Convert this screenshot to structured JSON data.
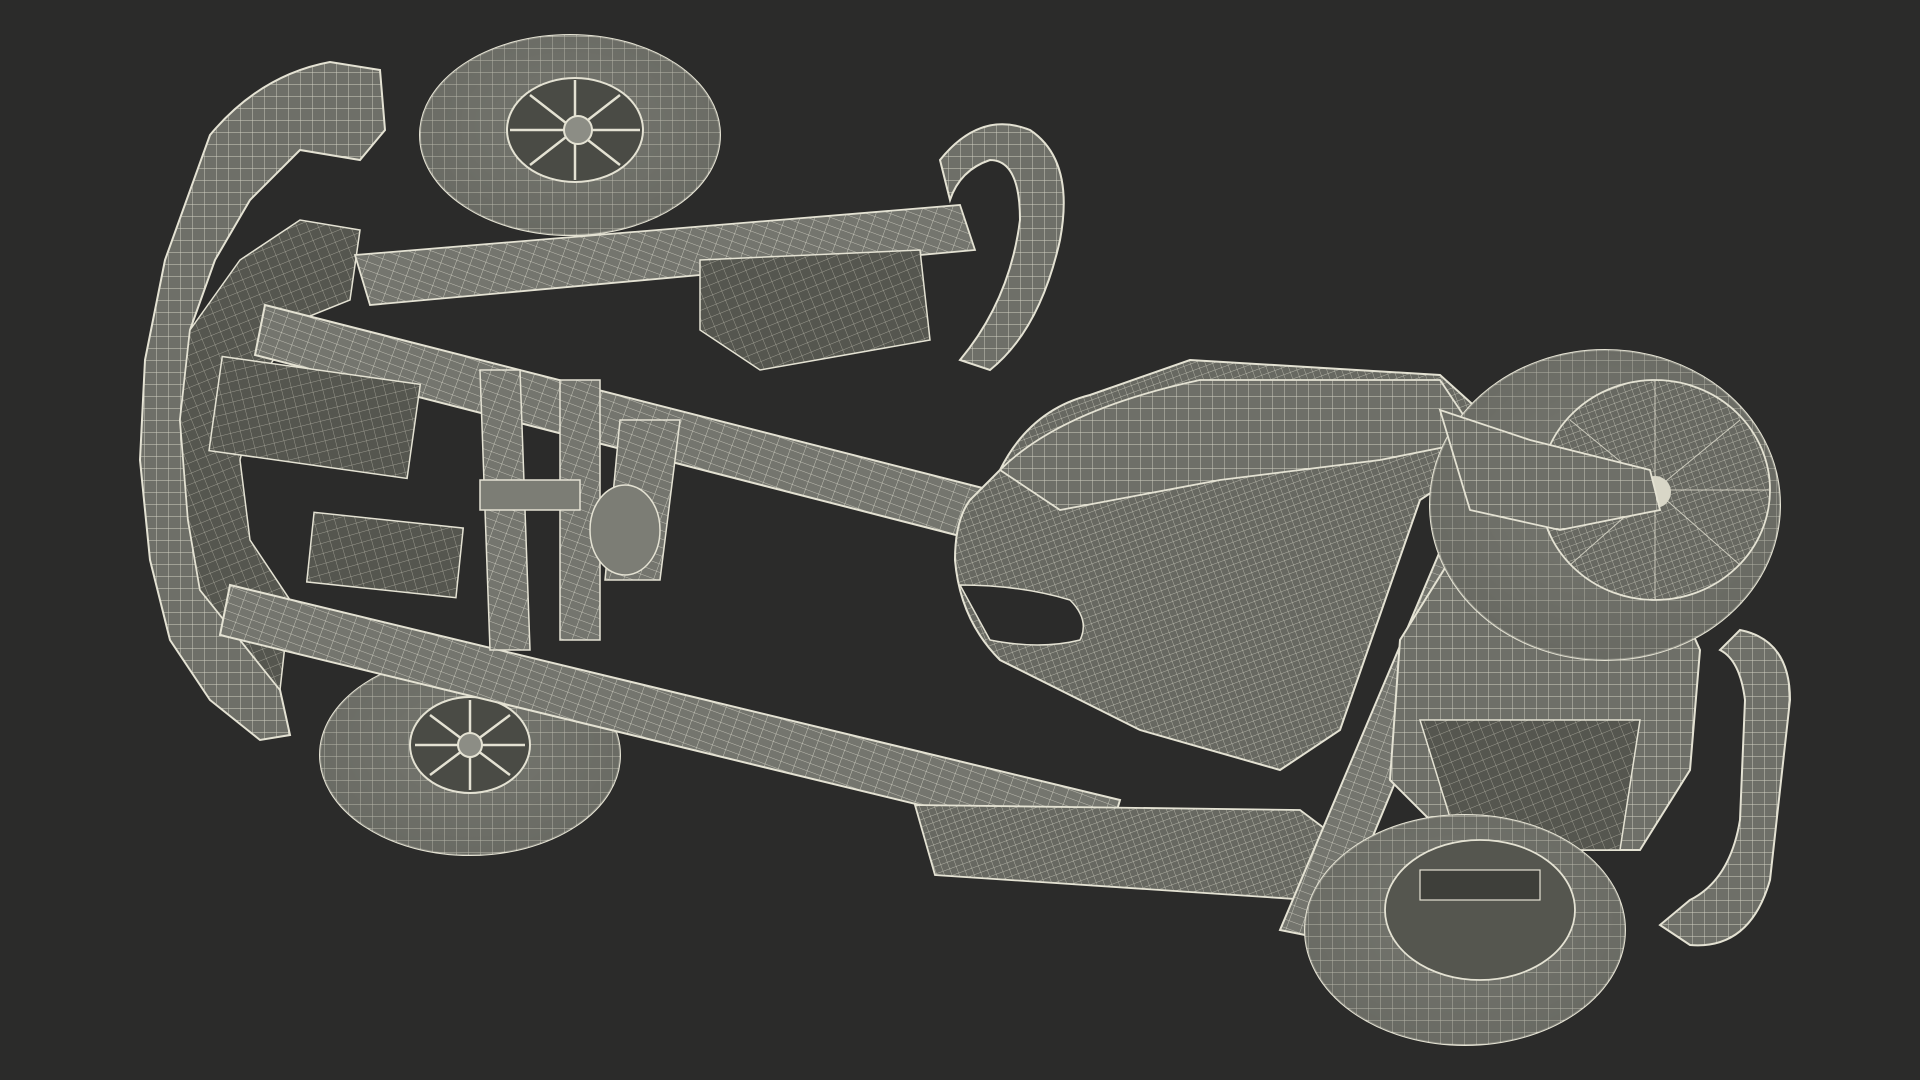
{
  "scene": {
    "background_color": "#2b2b2a",
    "surface_color": "#6e6f68",
    "surface_shadow": "#4f504a",
    "surface_highlight": "#8c8d85",
    "wire_color": "#e4e2d3",
    "subject": "go-kart-chassis-wireframe-underside"
  }
}
